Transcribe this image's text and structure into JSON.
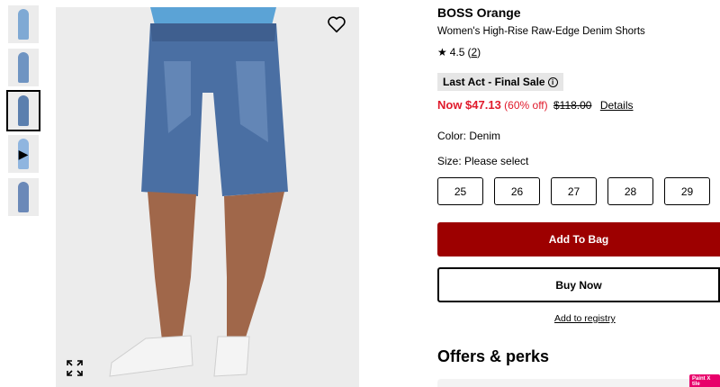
{
  "gallery": {
    "thumbnails": [
      {
        "name": "thumbnail-1",
        "tone": "#7fa9d4",
        "video": false
      },
      {
        "name": "thumbnail-2",
        "tone": "#6f94c2",
        "video": false
      },
      {
        "name": "thumbnail-3",
        "tone": "#5b7fae",
        "video": false,
        "active": true
      },
      {
        "name": "thumbnail-4",
        "tone": "#8fb5df",
        "video": true
      },
      {
        "name": "thumbnail-5",
        "tone": "#6b89b8",
        "video": false
      }
    ],
    "wishlist_icon": "heart-outline-icon",
    "expand_icon": "expand-icon"
  },
  "product": {
    "brand": "BOSS Orange",
    "name": "Women's High-Rise Raw-Edge Denim Shorts",
    "rating_value": "4.5",
    "rating_count": "2",
    "badge": "Last Act - Final Sale",
    "price_now": "Now $47.13",
    "discount": "(60% off)",
    "price_original": "$118.00",
    "details_link": "Details",
    "color_label": "Color: Denim",
    "size_label": "Size: Please select",
    "sizes": [
      "25",
      "26",
      "27",
      "28",
      "29"
    ]
  },
  "actions": {
    "add_to_bag": "Add To Bag",
    "buy_now": "Buy Now",
    "add_to_registry": "Add to registry"
  },
  "offers": {
    "title": "Offers & perks"
  },
  "extension_badge": "Paint X tile",
  "colors": {
    "sale_red": "#e01a2b",
    "bag_button": "#9d0000"
  }
}
